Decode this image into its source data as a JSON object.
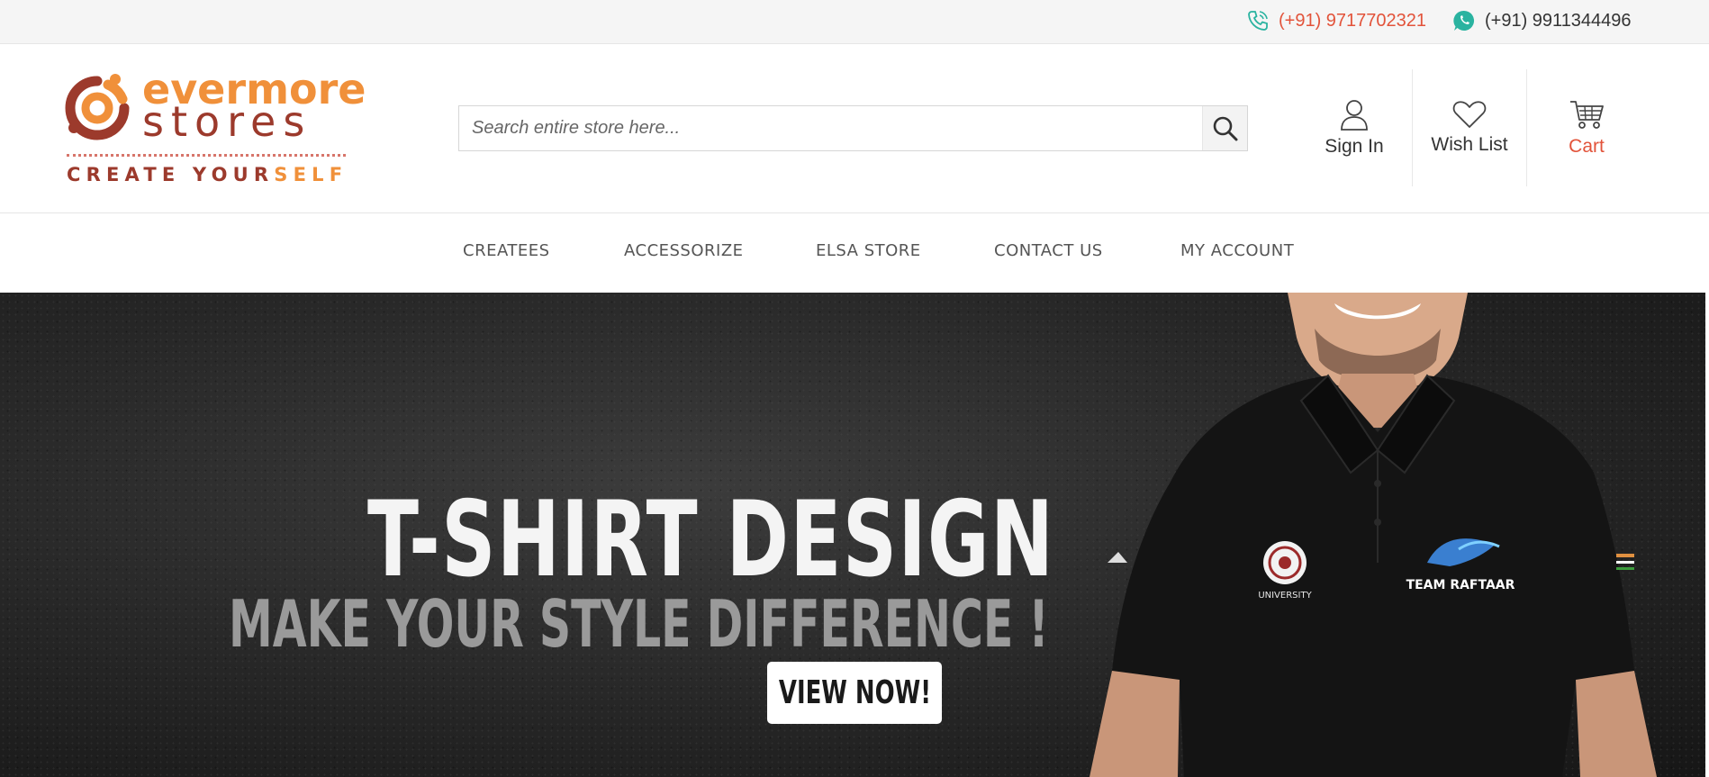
{
  "topbar": {
    "phone": "(+91) 9717702321",
    "whatsapp": "(+91) 9911344496",
    "phone_color": "#e2533a"
  },
  "logo": {
    "line1": "evermore",
    "line2": "stores",
    "tagline_a": "CREATE YOUR",
    "tagline_b": "SELF",
    "orange": "#f0903a",
    "brown": "#9c3a2c"
  },
  "search": {
    "placeholder": "Search entire store here...",
    "icon": "search-icon"
  },
  "header_links": {
    "signin": "Sign In",
    "wishlist": "Wish List",
    "cart": "Cart"
  },
  "nav": [
    "CREATEES",
    "ACCESSORIZE",
    "ELSA STORE",
    "CONTACT US",
    "MY ACCOUNT"
  ],
  "banner": {
    "title": "T-SHIRT DESIGN",
    "subtitle": "MAKE YOUR STYLE DIFFERENCE !",
    "cta": "VIEW NOW!",
    "shirt_logo_left": "UNIVERSITY",
    "shirt_logo_right": "TEAM RAFTAAR"
  }
}
